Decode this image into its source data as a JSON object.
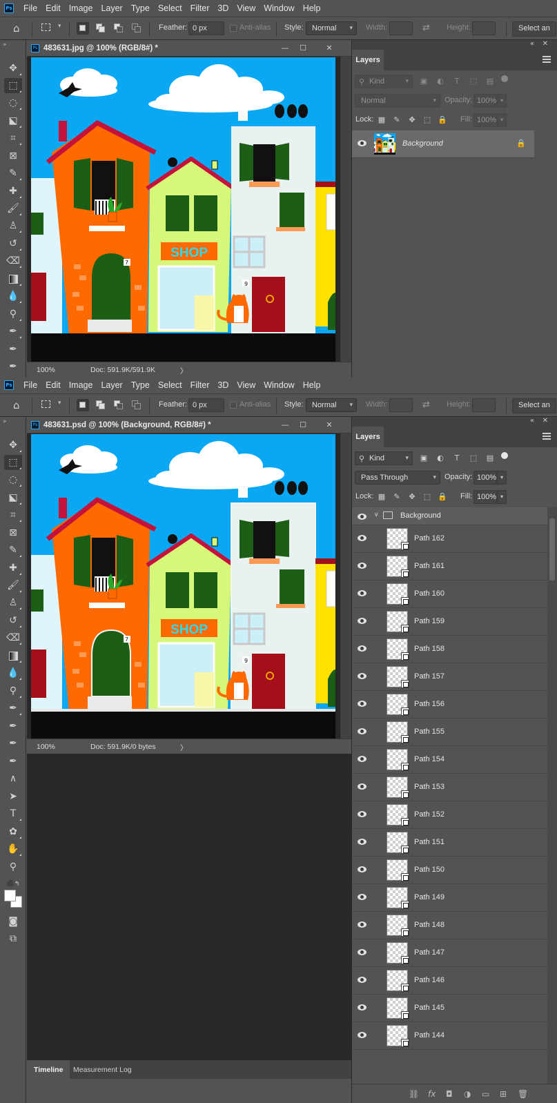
{
  "menu": [
    "File",
    "Edit",
    "Image",
    "Layer",
    "Type",
    "Select",
    "Filter",
    "3D",
    "View",
    "Window",
    "Help"
  ],
  "app_logo": "Ps",
  "options_bar": {
    "feather_label": "Feather:",
    "feather_value": "0 px",
    "antialias_label": "Anti-alias",
    "style_label": "Style:",
    "style_value": "Normal",
    "width_label": "Width:",
    "height_label": "Height:",
    "select_button": "Select an"
  },
  "top": {
    "doc_title": "483631.jpg @ 100% (RGB/8#) *",
    "zoom": "100%",
    "doc_info": "Doc: 591.9K/591.9K",
    "layers_tab": "Layers",
    "kind": "Kind",
    "blend_mode": "Normal",
    "opacity_label": "Opacity:",
    "opacity_value": "100%",
    "lock_label": "Lock:",
    "fill_label": "Fill:",
    "fill_value": "100%",
    "layer_name": "Background"
  },
  "bottom": {
    "doc_title": "483631.psd @ 100% (Background, RGB/8#) *",
    "zoom": "100%",
    "doc_info": "Doc: 591.9K/0 bytes",
    "layers_tab": "Layers",
    "kind": "Kind",
    "blend_mode": "Pass Through",
    "opacity_label": "Opacity:",
    "opacity_value": "100%",
    "lock_label": "Lock:",
    "fill_label": "Fill:",
    "fill_value": "100%",
    "group_name": "Background",
    "layers": [
      "Path 162",
      "Path 161",
      "Path 160",
      "Path 159",
      "Path 158",
      "Path 157",
      "Path 156",
      "Path 155",
      "Path 154",
      "Path 153",
      "Path 152",
      "Path 151",
      "Path 150",
      "Path 149",
      "Path 148",
      "Path 147",
      "Path 146",
      "Path 145",
      "Path 144"
    ]
  },
  "timeline_tabs": [
    "Timeline",
    "Measurement Log"
  ],
  "artwork": {
    "shop_sign": "SHOP",
    "door_number_left": "7",
    "door_number_right": "9"
  },
  "colors": {
    "sky": "#0aa7f5",
    "orange_house": "#ff6a00",
    "green_house": "#d6f77a",
    "white_house": "#e9f1f1",
    "yellow_house": "#ffe100",
    "ground": "#0b0b0d",
    "shop_text": "#33d6e6",
    "door_green": "#1d5e16",
    "door_red": "#a3101a",
    "roof": "#c4123a",
    "cat": "#ff6a00"
  }
}
